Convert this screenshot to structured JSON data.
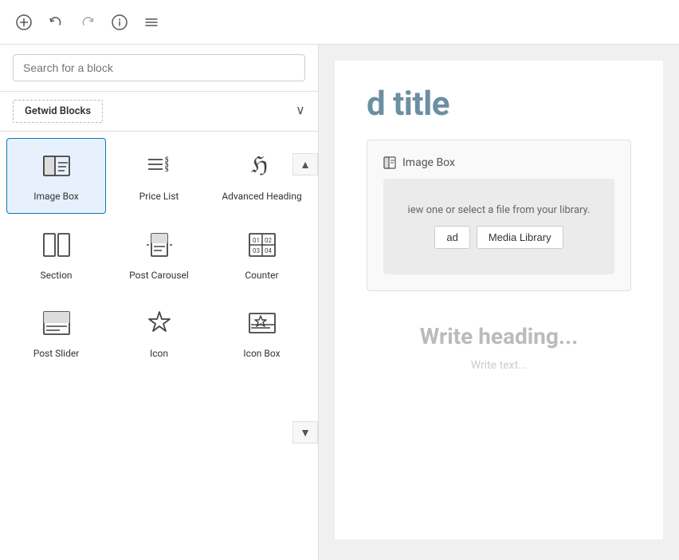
{
  "toolbar": {
    "add_label": "+",
    "undo_label": "↺",
    "redo_label": "↻",
    "info_label": "ℹ",
    "menu_label": "☰"
  },
  "inserter": {
    "search_placeholder": "Search for a block",
    "category_label": "Getwid Blocks",
    "scroll_up": "▲",
    "scroll_down": "▼"
  },
  "blocks": [
    {
      "id": "image-box",
      "label": "Image Box",
      "selected": true
    },
    {
      "id": "price-list",
      "label": "Price List",
      "selected": false
    },
    {
      "id": "advanced-heading",
      "label": "Advanced Heading",
      "selected": false
    },
    {
      "id": "section",
      "label": "Section",
      "selected": false
    },
    {
      "id": "post-carousel",
      "label": "Post Carousel",
      "selected": false
    },
    {
      "id": "counter",
      "label": "Counter",
      "selected": false
    },
    {
      "id": "post-slider",
      "label": "Post Slider",
      "selected": false
    },
    {
      "id": "icon",
      "label": "Icon",
      "selected": false
    },
    {
      "id": "icon-box",
      "label": "Icon Box",
      "selected": false
    }
  ],
  "editor": {
    "page_title": "d title",
    "image_box_header": "Image Box",
    "image_box_subtext": "iew one or select a file from your library.",
    "upload_btn": "ad",
    "media_library_btn": "Media Library",
    "write_heading": "Write heading...",
    "write_text": "Write text..."
  },
  "colors": {
    "accent": "#007cba",
    "title_color": "#6b8fa3"
  }
}
